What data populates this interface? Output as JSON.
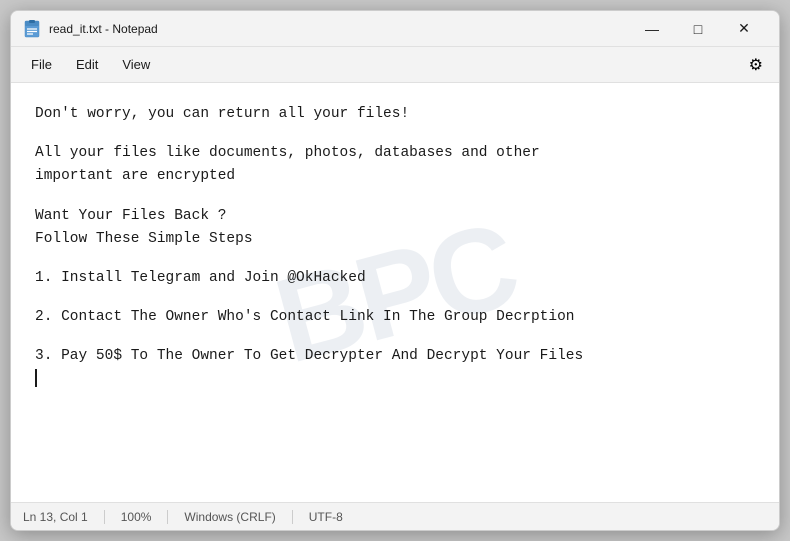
{
  "window": {
    "title": "read_it.txt - Notepad",
    "icon_label": "notepad-icon"
  },
  "controls": {
    "minimize": "—",
    "maximize": "□",
    "close": "✕"
  },
  "menu": {
    "file": "File",
    "edit": "Edit",
    "view": "View",
    "gear": "⚙"
  },
  "content": {
    "line1": "Don't worry, you can return all your files!",
    "line2a": "All your files like documents, photos, databases and other",
    "line2b": "important are encrypted",
    "line3a": "Want Your Files Back ?",
    "line3b": "Follow These Simple Steps",
    "line4": "1.  Install Telegram and Join @OkHacked",
    "line5": "2.  Contact The Owner Who's Contact Link In The Group Decrption",
    "line6": "3.  Pay 50$ To The Owner To Get Decrypter And Decrypt Your Files"
  },
  "statusbar": {
    "position": "Ln 13, Col 1",
    "zoom": "100%",
    "line_ending": "Windows (CRLF)",
    "encoding": "UTF-8"
  }
}
